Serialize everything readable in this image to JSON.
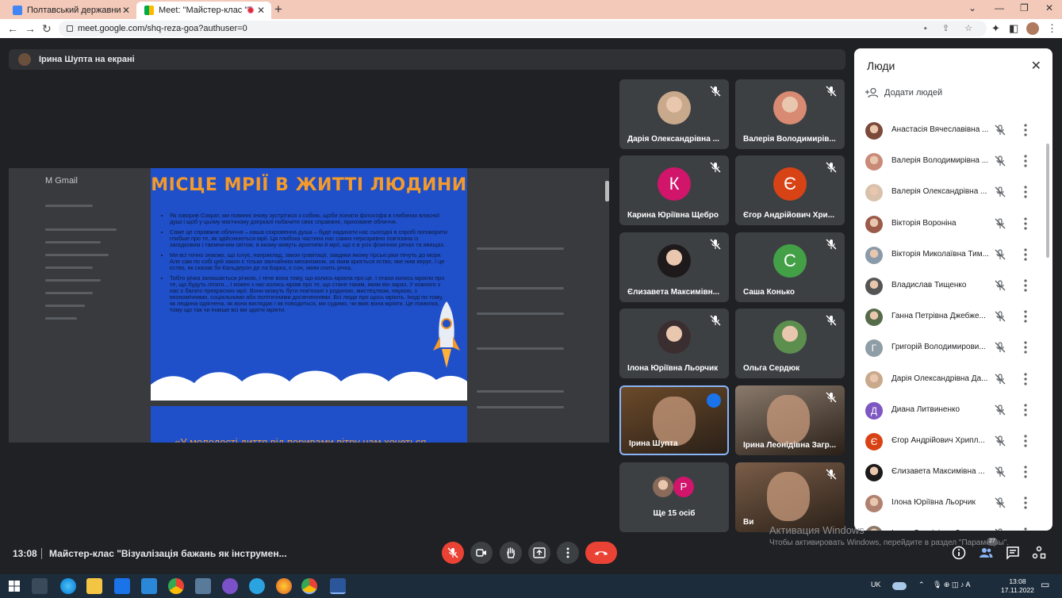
{
  "browser": {
    "tabs": [
      {
        "title": "Полтавський державний аграрн",
        "active": false
      },
      {
        "title": "Meet: \"Майстер-клас \"Візуа",
        "active": true
      }
    ],
    "url": "meet.google.com/shq-reza-goa?authuser=0"
  },
  "meet": {
    "presenting_label": "Ірина Шупта на екрані",
    "slide": {
      "title": "МІСЦЕ МРІЇ В ЖИТТІ ЛЮДИНИ",
      "bullets": [
        "Як говорив Сократ, ми повинні знову зустрітися з собою, щоби пізнати філософа в глибинах власної душі і щоб у цьому магічному дзеркалі побачити своє справжнє, приховане обличчя.",
        "Саме це справжнє обличчя – наша сокровенна душа – буде надихати нас сьогодні в спробі поговорити глибше про те, як здійснюються мрії. Ця глибока частина нас самих нерозривно пов'язана із загадковим і таємничим світом, в якому живуть архетипи й мрії, що є в усіх фізичних речах та явищах.",
        "Ми всі точно знаємо, що існує, наприклад, закон гравітації, завдяки якому гірські ріки течуть до моря. Але сам по собі цей закон є тільки звичайним механізмом, за яким криється єство, яке ним керує. І це єство, як сказав би Кальдерон де ла Барка, є сон, яким снить річка.",
        "Тобто річка залишається річкою, і тече вона тому, що колись мріяла про це. І птахи колись мріяли про те, що будуть літати... І кожен з нас колись мріяв про те, що стане таким, яким він зараз. У кожного з нас є багато прекрасних мрії. Вони можуть бути пов'язані з родиною, мистецтвом, наукою, з економічними, соціальними або політичними досягненнями. Всі люди про щось мріють. Іноді по тому, як людина одягнена, як вона виглядає і як поводиться, ми судимо, чи вміє вона мріяти. Це помилка, тому що так чи інакше всі ми здатні мріяти."
      ],
      "next_slide_text": "«У молодості диття від поривами вітру нам хочеться"
    },
    "tiles": [
      {
        "name": "Дарія Олександрівна ...",
        "kind": "photo",
        "muted": true,
        "color": "#c9a98c"
      },
      {
        "name": "Валерія Володимирів...",
        "kind": "photo",
        "muted": true,
        "color": "#d88a72"
      },
      {
        "name": "Карина Юріївна Щебро",
        "kind": "initial",
        "initial": "К",
        "muted": true,
        "color": "#d0156b"
      },
      {
        "name": "Єгор Андрійович Хри...",
        "kind": "initial",
        "initial": "Є",
        "muted": true,
        "color": "#d84315"
      },
      {
        "name": "Єлизавета Максимівн...",
        "kind": "photo",
        "muted": true,
        "color": "#1e1a1b"
      },
      {
        "name": "Саша Конько",
        "kind": "initial",
        "initial": "С",
        "muted": true,
        "color": "#43a047"
      },
      {
        "name": "Ілона Юріївна Льорчик",
        "kind": "photo",
        "muted": true,
        "color": "#3b2e30"
      },
      {
        "name": "Ольга Сердюк",
        "kind": "photo",
        "muted": true,
        "color": "#5c8f4e"
      },
      {
        "name": "Ірина Шупта",
        "kind": "video",
        "muted": false,
        "color": "#6b4a2a"
      },
      {
        "name": "Ірина Леонідівна Загр...",
        "kind": "video",
        "muted": true,
        "color": "#8a7a6c"
      },
      {
        "name": "Ще 15 осіб",
        "kind": "more",
        "muted": false,
        "color": "#3c4043"
      },
      {
        "name": "Ви",
        "kind": "video",
        "muted": true,
        "color": "#7a5d48"
      }
    ],
    "people_panel": {
      "title": "Люди",
      "add_people": "Додати людей",
      "people": [
        {
          "name": "Анастасія Вячеславівна ...",
          "avatar": "photo",
          "color": "#7b4a3a"
        },
        {
          "name": "Валерія Володимирівна ...",
          "avatar": "photo",
          "color": "#c98a78"
        },
        {
          "name": "Валерія Олександрівна ...",
          "avatar": "photo",
          "color": "#d9c2ad"
        },
        {
          "name": "Вікторія Вороніна",
          "avatar": "photo",
          "color": "#9c5a4a"
        },
        {
          "name": "Вікторія Миколаївна Тим...",
          "avatar": "photo",
          "color": "#8a9aa8"
        },
        {
          "name": "Владислав Тищенко",
          "avatar": "photo",
          "color": "#555"
        },
        {
          "name": "Ганна Петрівна Джебже...",
          "avatar": "photo",
          "color": "#556b4a"
        },
        {
          "name": "Григорій Володимирови...",
          "avatar": "initial",
          "initial": "Г",
          "color": "#8f9ea6"
        },
        {
          "name": "Дарія Олександрівна Да...",
          "avatar": "photo",
          "color": "#c9a98c"
        },
        {
          "name": "Диана Литвиненко",
          "avatar": "initial",
          "initial": "Д",
          "color": "#7e57c2"
        },
        {
          "name": "Єгор Андрійович Хрипл...",
          "avatar": "initial",
          "initial": "Є",
          "color": "#d84315"
        },
        {
          "name": "Єлизавета Максимівна ...",
          "avatar": "photo",
          "color": "#1e1a1b"
        },
        {
          "name": "Ілона Юріївна Льорчик",
          "avatar": "photo",
          "color": "#b08070"
        },
        {
          "name": "Ірина Леонідівна Загр...",
          "avatar": "photo",
          "color": "#8a7a6c"
        }
      ]
    },
    "bottom_bar": {
      "time": "13:08",
      "meeting_title": "Майстер-клас \"Візуалізація бажань як інструмен...",
      "participants_badge": "27"
    },
    "watermark": {
      "line1": "Активация Windows",
      "line2": "Чтобы активировать Windows, перейдите в раздел \"Параметры\"."
    }
  },
  "taskbar": {
    "lang": "UK",
    "time": "13:08",
    "date": "17.11.2022"
  }
}
